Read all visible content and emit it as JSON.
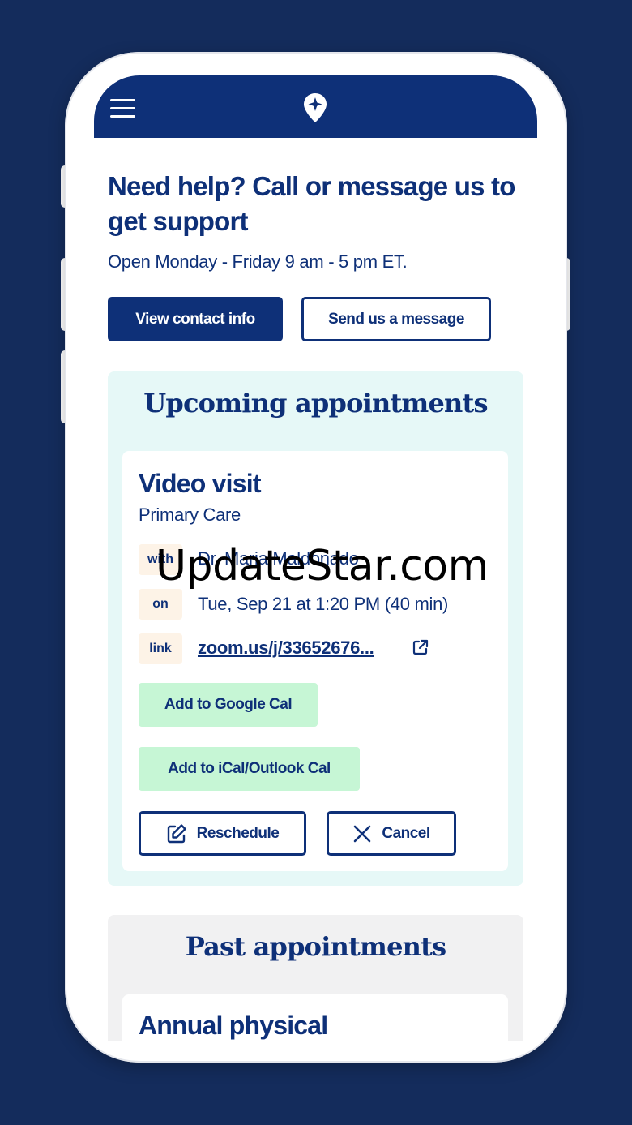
{
  "header": {
    "menu_icon": "hamburger-icon",
    "logo_icon": "location-star-logo"
  },
  "support": {
    "title": "Need help? Call or message us to get support",
    "hours": "Open Monday - Friday 9 am - 5 pm ET.",
    "contact_button": "View contact info",
    "message_button": "Send us a message"
  },
  "upcoming": {
    "section_title": "Upcoming appointments",
    "appointment": {
      "title": "Video visit",
      "subtitle": "Primary Care",
      "with_tag": "with",
      "with_value": "Dr. Maria Maldonado",
      "on_tag": "on",
      "on_value": "Tue, Sep 21 at 1:20 PM (40 min)",
      "link_tag": "link",
      "link_value": "zoom.us/j/33652676...",
      "google_cal_button": "Add to Google Cal",
      "ical_button": "Add to iCal/Outlook Cal",
      "reschedule_button": "Reschedule",
      "cancel_button": "Cancel"
    }
  },
  "past": {
    "section_title": "Past appointments",
    "appointment_title": "Annual physical"
  },
  "watermark": "UpdateStar.com",
  "colors": {
    "background": "#142c5c",
    "brand_navy": "#0e3078",
    "upcoming_bg": "#e6f8f7",
    "tag_bg": "#fdf3e7",
    "calendar_button_bg": "#c6f6d5",
    "past_bg": "#f1f1f2"
  }
}
